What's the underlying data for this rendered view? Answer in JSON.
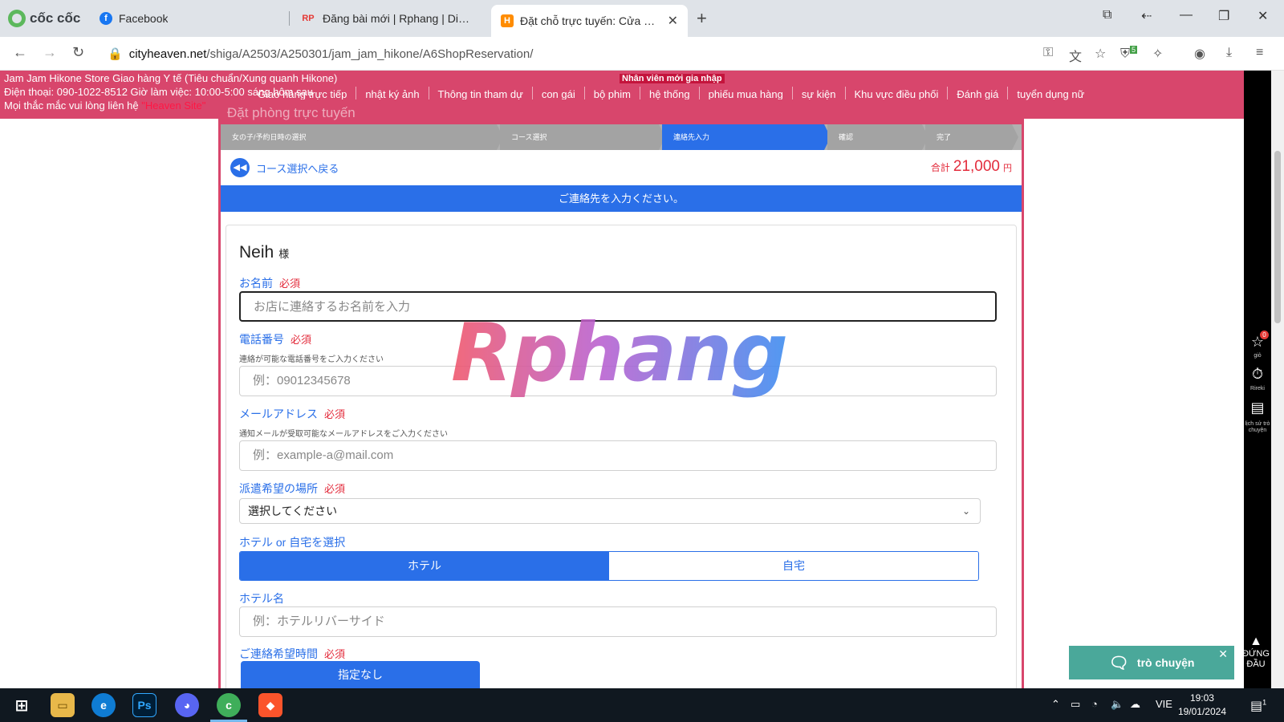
{
  "browser": {
    "brand": "cốc cốc",
    "tabs": [
      {
        "title": "Facebook",
        "favicon_text": "f",
        "favicon_color": "#1877f2"
      },
      {
        "title": "Đăng bài mới | Rphang | Diễn Đàn",
        "favicon_text": "RP",
        "favicon_color": "#e53935"
      },
      {
        "title": "Đặt chỗ trực tuyến: Cửa hàng",
        "favicon_text": "H",
        "favicon_color": "#ff8c00",
        "active": true
      }
    ],
    "url_host": "cityheaven.net",
    "url_path": "/shiga/A2503/A250301/jam_jam_hikone/A6ShopReservation/",
    "extension_badge": "5"
  },
  "header": {
    "store_line": "Jam Jam Hikone Store Giao hàng Y tế (Tiêu chuẩn/Xung quanh Hikone)",
    "phone_line": "Điện thoại: 090-1022-8512 Giờ làm việc: 10:00-5:00 sáng hôm sau",
    "contact_line": "Mọi thắc mắc vui lòng liên hệ",
    "contact_link": "\"Heaven Site\"",
    "new_badge": "Nhân viên mới gia nhập",
    "menu": [
      "Giao hàng trực tiếp",
      "nhật ký ảnh",
      "Thông tin tham dự",
      "con gái",
      "bộ phim",
      "hệ thống",
      "phiếu mua hàng",
      "sự kiện",
      "Khu vực điều phối",
      "Đánh giá",
      "tuyển dụng nữ"
    ]
  },
  "modal": {
    "title": "Đặt phòng trực tuyến",
    "steps": [
      "女の子/予約日時の選択",
      "コース選択",
      "連絡先入力",
      "確認",
      "完了"
    ],
    "active_step": 2,
    "back_label": "コース選択へ戻る",
    "total_label": "合計",
    "total_value": "21,000",
    "total_unit": "円",
    "banner": "ご連絡先を入力ください。"
  },
  "form": {
    "customer_name": "Neih",
    "honorific": "様",
    "required_tag": "必須",
    "name_label": "お名前",
    "name_placeholder": "お店に連絡するお名前を入力",
    "phone_label": "電話番号",
    "phone_hint": "連絡が可能な電話番号をご入力ください",
    "phone_placeholder": "例：09012345678",
    "email_label": "メールアドレス",
    "email_hint": "通知メールが受取可能なメールアドレスをご入力ください",
    "email_placeholder": "例：example-a@mail.com",
    "place_label": "派遣希望の場所",
    "place_selected": "選択してください",
    "hotel_home_label": "ホテル or 自宅を選択",
    "hotel_option": "ホテル",
    "home_option": "自宅",
    "hotel_name_label": "ホテル名",
    "hotel_name_placeholder": "例：ホテルリバーサイド",
    "contact_time_label": "ご連絡希望時間",
    "contact_time_button": "指定なし"
  },
  "watermark": "Rphang",
  "rail": {
    "fav_badge": "0",
    "fav_label": "giỏ",
    "history_label": "Rireki",
    "chat_label": "lịch sử trò chuyện"
  },
  "chat_widget": "trò chuyện",
  "top_button": "ĐỨNG ĐẦU",
  "taskbar": {
    "language": "VIE",
    "time": "19:03",
    "date": "19/01/2024",
    "notification_count": "1"
  },
  "colors": {
    "header_pink": "#d8466c",
    "primary_blue": "#2a6fe8",
    "price_red": "#e32c3c",
    "chat_teal": "#4aa89a"
  }
}
